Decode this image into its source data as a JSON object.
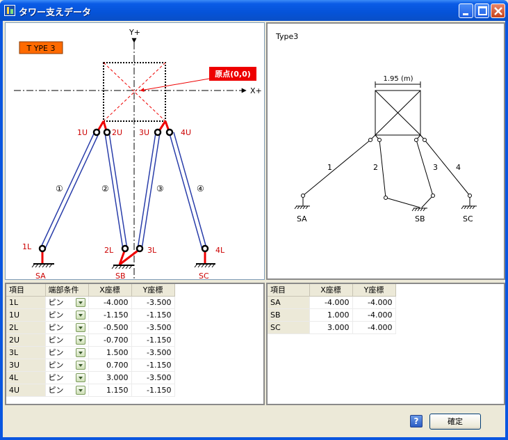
{
  "window": {
    "title": "タワー支えデータ"
  },
  "type_badge": "T YPE 3",
  "diagram": {
    "y_axis_label": "Y+",
    "x_axis_label": "X+",
    "origin_label": "原点(0,0)",
    "points": {
      "u1": "1U",
      "u2": "2U",
      "u3": "3U",
      "u4": "4U",
      "l1": "1L",
      "l2": "2L",
      "l3": "3L",
      "l4": "4L"
    },
    "members": {
      "m1": "①",
      "m2": "②",
      "m3": "③",
      "m4": "④"
    },
    "supports": {
      "sa": "SA",
      "sb": "SB",
      "sc": "SC"
    }
  },
  "preview": {
    "title": "Type3",
    "dimension": "1.95 (m)",
    "members": {
      "m1": "1",
      "m2": "2",
      "m3": "3",
      "m4": "4"
    },
    "supports": {
      "sa": "SA",
      "sb": "SB",
      "sc": "SC"
    }
  },
  "points_table": {
    "headers": [
      "項目",
      "端部条件",
      "X座標",
      "Y座標"
    ],
    "rows": [
      {
        "item": "1L",
        "cond": "ピン",
        "x": "-4.000",
        "y": "-3.500"
      },
      {
        "item": "1U",
        "cond": "ピン",
        "x": "-1.150",
        "y": "-1.150"
      },
      {
        "item": "2L",
        "cond": "ピン",
        "x": "-0.500",
        "y": "-3.500"
      },
      {
        "item": "2U",
        "cond": "ピン",
        "x": "-0.700",
        "y": "-1.150"
      },
      {
        "item": "3L",
        "cond": "ピン",
        "x": "1.500",
        "y": "-3.500"
      },
      {
        "item": "3U",
        "cond": "ピン",
        "x": "0.700",
        "y": "-1.150"
      },
      {
        "item": "4L",
        "cond": "ピン",
        "x": "3.000",
        "y": "-3.500"
      },
      {
        "item": "4U",
        "cond": "ピン",
        "x": "1.150",
        "y": "-1.150"
      }
    ]
  },
  "supports_table": {
    "headers": [
      "項目",
      "X座標",
      "Y座標"
    ],
    "rows": [
      {
        "item": "SA",
        "x": "-4.000",
        "y": "-4.000"
      },
      {
        "item": "SB",
        "x": "1.000",
        "y": "-4.000"
      },
      {
        "item": "SC",
        "x": "3.000",
        "y": "-4.000"
      }
    ]
  },
  "buttons": {
    "help": "?",
    "ok": "確定"
  },
  "colors": {
    "badge": "#ff6a00",
    "member": "#2a3eaa",
    "point_label": "#cc0000",
    "accent_red": "#ff0000"
  }
}
